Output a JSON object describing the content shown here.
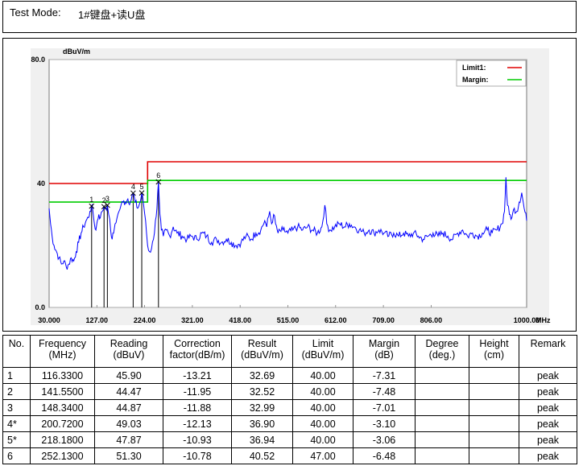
{
  "header": {
    "label": "Test Mode:",
    "value": "1#键盘+读U盘"
  },
  "chart_data": {
    "type": "line",
    "title": "",
    "ylabel": "dBuV/m",
    "xunit": "MHz",
    "ylim": [
      0,
      80
    ],
    "xlim": [
      30,
      1000
    ],
    "y_ticks": [
      "80.0",
      "40",
      "0.0"
    ],
    "x_ticks": [
      "30.000",
      "127.00",
      "224.00",
      "321.00",
      "418.00",
      "515.00",
      "612.00",
      "709.00",
      "806.00",
      "1000.00"
    ],
    "legend": {
      "position": "top-right",
      "entries": [
        {
          "name": "Limit1:",
          "color": "#e00000"
        },
        {
          "name": "Margin:",
          "color": "#00cc00"
        }
      ]
    },
    "limit_line": [
      [
        30,
        40
      ],
      [
        230,
        40
      ],
      [
        230,
        47
      ],
      [
        1000,
        47
      ]
    ],
    "margin_line": [
      [
        30,
        34
      ],
      [
        230,
        34
      ],
      [
        230,
        41
      ],
      [
        1000,
        41
      ]
    ],
    "trace_color": "#0000ff",
    "trace": [
      [
        30,
        32
      ],
      [
        33,
        27
      ],
      [
        36,
        23
      ],
      [
        40,
        20
      ],
      [
        45,
        18
      ],
      [
        50,
        16
      ],
      [
        55,
        14
      ],
      [
        60,
        15
      ],
      [
        65,
        13
      ],
      [
        70,
        14
      ],
      [
        75,
        16
      ],
      [
        80,
        15
      ],
      [
        85,
        18
      ],
      [
        90,
        21
      ],
      [
        95,
        24
      ],
      [
        100,
        26
      ],
      [
        105,
        28
      ],
      [
        110,
        29
      ],
      [
        113,
        31
      ],
      [
        116,
        32.7
      ],
      [
        119,
        31
      ],
      [
        122,
        27
      ],
      [
        125,
        25
      ],
      [
        128,
        28
      ],
      [
        131,
        30
      ],
      [
        134,
        29
      ],
      [
        138,
        31
      ],
      [
        141.5,
        32.5
      ],
      [
        145,
        32
      ],
      [
        148.3,
        33
      ],
      [
        151,
        30
      ],
      [
        155,
        25
      ],
      [
        158,
        22
      ],
      [
        161,
        24
      ],
      [
        164,
        27
      ],
      [
        168,
        29
      ],
      [
        172,
        31
      ],
      [
        176,
        33
      ],
      [
        180,
        34
      ],
      [
        185,
        34
      ],
      [
        190,
        35
      ],
      [
        195,
        34
      ],
      [
        200.7,
        36.9
      ],
      [
        205,
        34
      ],
      [
        210,
        32
      ],
      [
        215,
        34
      ],
      [
        218.2,
        36.9
      ],
      [
        222,
        33
      ],
      [
        226,
        28
      ],
      [
        230,
        20
      ],
      [
        234,
        18
      ],
      [
        238,
        19
      ],
      [
        242,
        22
      ],
      [
        246,
        28
      ],
      [
        249,
        32
      ],
      [
        252.1,
        40.5
      ],
      [
        255,
        30
      ],
      [
        258,
        25
      ],
      [
        262,
        23
      ],
      [
        268,
        25
      ],
      [
        275,
        23
      ],
      [
        282,
        26
      ],
      [
        290,
        24
      ],
      [
        300,
        23
      ],
      [
        310,
        22
      ],
      [
        320,
        23
      ],
      [
        330,
        22
      ],
      [
        340,
        24
      ],
      [
        350,
        23
      ],
      [
        360,
        21
      ],
      [
        370,
        22
      ],
      [
        380,
        21
      ],
      [
        390,
        22
      ],
      [
        400,
        21
      ],
      [
        410,
        20
      ],
      [
        420,
        21
      ],
      [
        430,
        23
      ],
      [
        440,
        22
      ],
      [
        450,
        24
      ],
      [
        460,
        25
      ],
      [
        468,
        28
      ],
      [
        472,
        26
      ],
      [
        478,
        31
      ],
      [
        482,
        27
      ],
      [
        486,
        30
      ],
      [
        490,
        27
      ],
      [
        495,
        24
      ],
      [
        505,
        25
      ],
      [
        515,
        24
      ],
      [
        525,
        25
      ],
      [
        535,
        26
      ],
      [
        545,
        25
      ],
      [
        555,
        26
      ],
      [
        565,
        25
      ],
      [
        575,
        24
      ],
      [
        584,
        26
      ],
      [
        590,
        33
      ],
      [
        594,
        27
      ],
      [
        600,
        25
      ],
      [
        610,
        26
      ],
      [
        620,
        27
      ],
      [
        630,
        26
      ],
      [
        640,
        27
      ],
      [
        650,
        26
      ],
      [
        660,
        25
      ],
      [
        670,
        24
      ],
      [
        680,
        25
      ],
      [
        690,
        24
      ],
      [
        700,
        25
      ],
      [
        710,
        24
      ],
      [
        720,
        23
      ],
      [
        730,
        24
      ],
      [
        740,
        23
      ],
      [
        750,
        24
      ],
      [
        760,
        23
      ],
      [
        770,
        24
      ],
      [
        780,
        23
      ],
      [
        790,
        22
      ],
      [
        800,
        23
      ],
      [
        810,
        24
      ],
      [
        820,
        23
      ],
      [
        830,
        24
      ],
      [
        840,
        23
      ],
      [
        850,
        22
      ],
      [
        860,
        24
      ],
      [
        870,
        25
      ],
      [
        880,
        23
      ],
      [
        890,
        24
      ],
      [
        900,
        23
      ],
      [
        910,
        24
      ],
      [
        920,
        25
      ],
      [
        930,
        24
      ],
      [
        940,
        25
      ],
      [
        950,
        27
      ],
      [
        955,
        31
      ],
      [
        958,
        42
      ],
      [
        961,
        33
      ],
      [
        965,
        30
      ],
      [
        970,
        29
      ],
      [
        975,
        32
      ],
      [
        980,
        31
      ],
      [
        985,
        34
      ],
      [
        990,
        37
      ],
      [
        995,
        32
      ],
      [
        1000,
        28
      ]
    ],
    "markers": [
      {
        "label": "1",
        "freq": 116.33,
        "level": 32.69
      },
      {
        "label": "2",
        "freq": 141.55,
        "level": 32.52
      },
      {
        "label": "3",
        "freq": 148.34,
        "level": 32.99
      },
      {
        "label": "4",
        "freq": 200.72,
        "level": 36.9
      },
      {
        "label": "5",
        "freq": 218.18,
        "level": 36.94
      },
      {
        "label": "6",
        "freq": 252.13,
        "level": 40.52
      }
    ]
  },
  "table": {
    "headers": [
      [
        "No."
      ],
      [
        "Frequency",
        "(MHz)"
      ],
      [
        "Reading",
        "(dBuV)"
      ],
      [
        "Correction",
        "factor(dB/m)"
      ],
      [
        "Result",
        "(dBuV/m)"
      ],
      [
        "Limit",
        "(dBuV/m)"
      ],
      [
        "Margin",
        "(dB)"
      ],
      [
        "Degree",
        "(deg.)"
      ],
      [
        "Height",
        "(cm)"
      ],
      [
        "Remark"
      ]
    ],
    "rows": [
      [
        "1",
        "116.3300",
        "45.90",
        "-13.21",
        "32.69",
        "40.00",
        "-7.31",
        "",
        "",
        "peak"
      ],
      [
        "2",
        "141.5500",
        "44.47",
        "-11.95",
        "32.52",
        "40.00",
        "-7.48",
        "",
        "",
        "peak"
      ],
      [
        "3",
        "148.3400",
        "44.87",
        "-11.88",
        "32.99",
        "40.00",
        "-7.01",
        "",
        "",
        "peak"
      ],
      [
        "4*",
        "200.7200",
        "49.03",
        "-12.13",
        "36.90",
        "40.00",
        "-3.10",
        "",
        "",
        "peak"
      ],
      [
        "5*",
        "218.1800",
        "47.87",
        "-10.93",
        "36.94",
        "40.00",
        "-3.06",
        "",
        "",
        "peak"
      ],
      [
        "6",
        "252.1300",
        "51.30",
        "-10.78",
        "40.52",
        "47.00",
        "-6.48",
        "",
        "",
        "peak"
      ]
    ]
  }
}
